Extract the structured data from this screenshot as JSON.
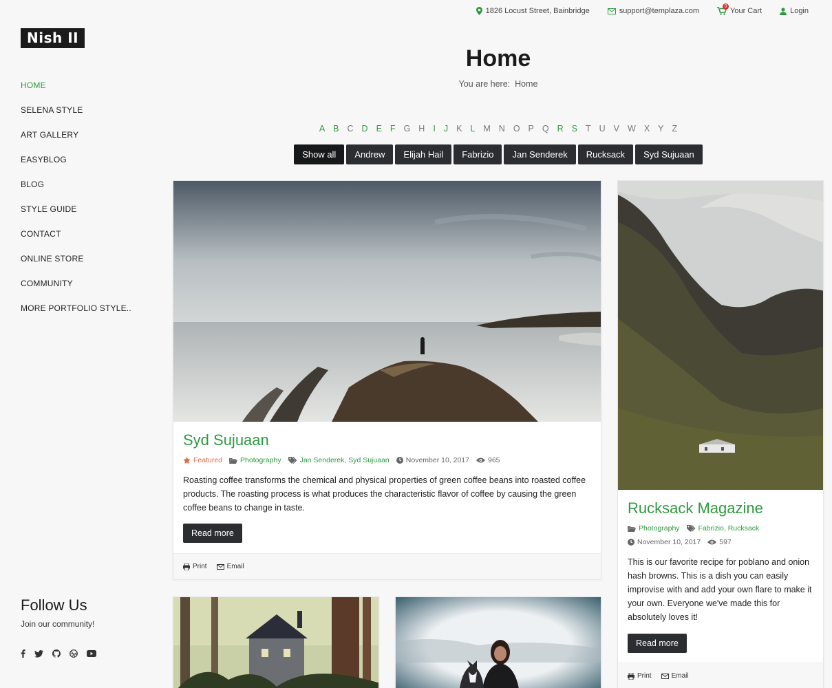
{
  "topbar": {
    "address": "1826 Locust Street, Bainbridge",
    "email": "support@templaza.com",
    "cart_label": "Your Cart",
    "cart_count": "0",
    "login_label": "Login"
  },
  "logo": "Nish II",
  "nav": [
    {
      "label": "HOME",
      "active": true
    },
    {
      "label": "SELENA STYLE"
    },
    {
      "label": "ART GALLERY"
    },
    {
      "label": "EASYBLOG"
    },
    {
      "label": "BLOG"
    },
    {
      "label": "STYLE GUIDE"
    },
    {
      "label": "CONTACT"
    },
    {
      "label": "ONLINE STORE"
    },
    {
      "label": "COMMUNITY"
    },
    {
      "label": "MORE PORTFOLIO STYLE.."
    }
  ],
  "follow": {
    "title": "Follow Us",
    "subtitle": "Join our community!"
  },
  "social_icons": [
    "facebook-icon",
    "twitter-icon",
    "github-icon",
    "dribbble-icon",
    "youtube-icon"
  ],
  "page": {
    "title": "Home",
    "breadcrumb_prefix": "You are here:",
    "breadcrumb_current": "Home"
  },
  "alphabet": [
    "A",
    "B",
    "C",
    "D",
    "E",
    "F",
    "G",
    "H",
    "I",
    "J",
    "K",
    "L",
    "M",
    "N",
    "O",
    "P",
    "Q",
    "R",
    "S",
    "T",
    "U",
    "V",
    "W",
    "X",
    "Y",
    "Z"
  ],
  "alphabet_active": [
    "A",
    "B",
    "D",
    "E",
    "F",
    "I",
    "J",
    "L",
    "R",
    "S"
  ],
  "filters": [
    "Show all",
    "Andrew",
    "Elijah Hail",
    "Fabrizio",
    "Jan Senderek",
    "Rucksack",
    "Syd Sujuaan"
  ],
  "card1": {
    "title": "Syd Sujuaan",
    "featured": "Featured",
    "category": "Photography",
    "tags": "Jan Senderek, Syd Sujuaan",
    "date": "November 10, 2017",
    "views": "965",
    "text": "Roasting coffee transforms the chemical and physical properties of green coffee beans into roasted coffee products. The roasting process is what produces the characteristic flavor of coffee by causing the green coffee beans to change in taste.",
    "read_more": "Read more",
    "print": "Print",
    "email": "Email"
  },
  "card2": {
    "title": "Rucksack Magazine",
    "category": "Photography",
    "tags": "Fabrizio, Rucksack",
    "date": "November 10, 2017",
    "views": "597",
    "text": "This is our favorite recipe for poblano and onion hash browns. This is a dish you can easily improvise with and add your own flare to make it your own. Everyone we've made this for absolutely loves it!",
    "read_more": "Read more",
    "print": "Print",
    "email": "Email"
  },
  "colors": {
    "accent": "#2e9a3f",
    "dark_button": "#2b2d31",
    "featured": "#e06a4a"
  }
}
